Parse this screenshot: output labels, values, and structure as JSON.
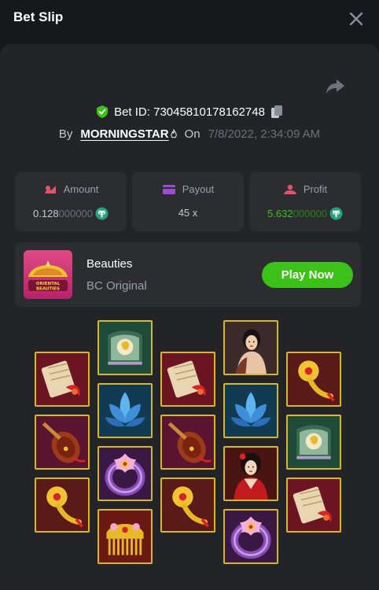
{
  "header": {
    "title": "Bet Slip",
    "close_icon": "close-icon"
  },
  "bet": {
    "bet_id_label": "Bet ID: 73045810178162748",
    "by_label": "By",
    "username": "MORNINGSTAR",
    "on_label": "On",
    "date": "7/8/2022, 2:34:09 AM",
    "share_icon": "share-icon",
    "copy_icon": "copy-icon",
    "shield_icon": "shield-check-icon"
  },
  "stats": {
    "amount": {
      "label": "Amount",
      "value_main": "0.128",
      "value_tail": "000000",
      "icon": "amount-icon",
      "coin_icon": "tether-coin-icon"
    },
    "payout": {
      "label": "Payout",
      "value": "45 x",
      "icon": "wallet-icon"
    },
    "profit": {
      "label": "Profit",
      "value_main": "5.632",
      "value_tail": "000000",
      "icon": "profit-icon",
      "coin_icon": "tether-coin-icon"
    }
  },
  "game": {
    "name": "Beauties",
    "subtitle": "BC Original",
    "play_label": "Play Now",
    "thumb_text": "ORIENTAL BEAUTIES"
  },
  "colors": {
    "background": "#17181b",
    "panel": "#232427",
    "card": "#2b2d31",
    "accent_green": "#3bc117",
    "profit_green": "#3bc117",
    "tile_border": "#d7b72a"
  },
  "reels": [
    [
      "book",
      "pipa",
      "ruyi"
    ],
    [
      "fan",
      "lotus",
      "ring",
      "comb"
    ],
    [
      "book",
      "pipa",
      "ruyi"
    ],
    [
      "lady",
      "lotus",
      "lady2",
      "ring"
    ],
    [
      "ruyi",
      "fan",
      "book"
    ]
  ]
}
